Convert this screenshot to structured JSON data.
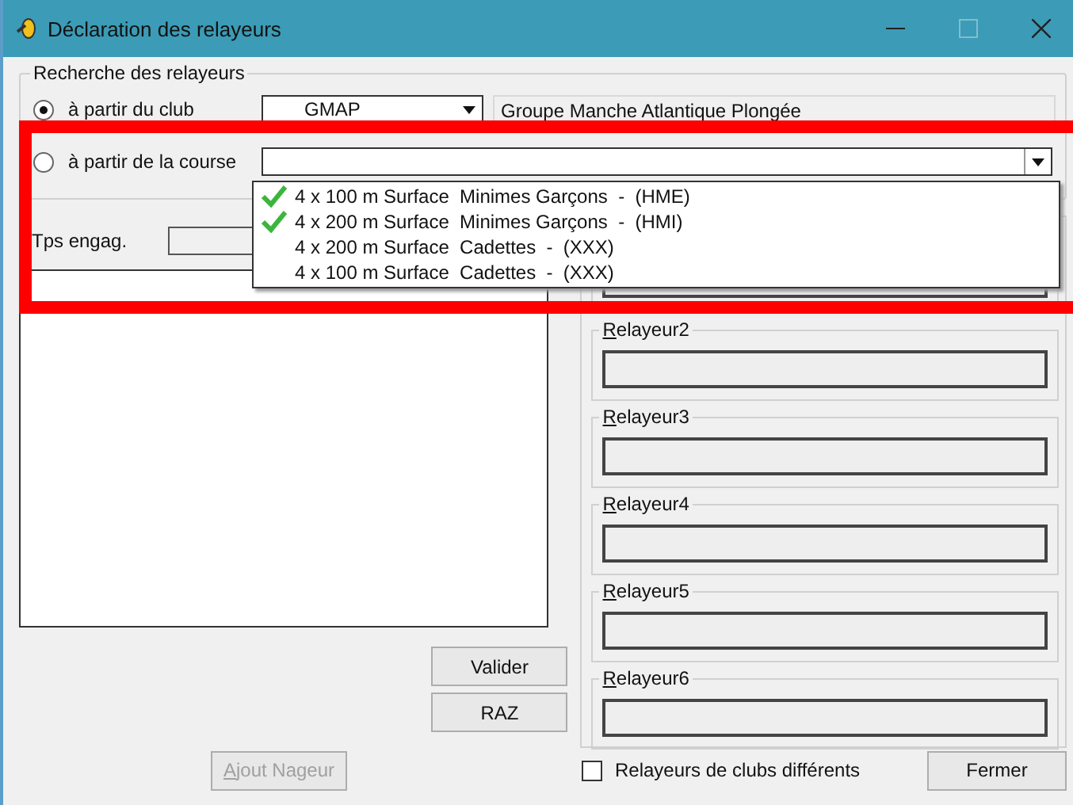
{
  "window": {
    "title": "Déclaration des relayeurs"
  },
  "search_group": {
    "legend": "Recherche des relayeurs",
    "club_option": {
      "label": "à partir du club",
      "selected": true,
      "combo_value": "GMAP",
      "club_name": "Groupe Manche Atlantique Plongée"
    },
    "course_option": {
      "label": "à partir de la course",
      "selected": false
    }
  },
  "course_dropdown": {
    "items": [
      {
        "label": "4 x 100 m Surface  Minimes Garçons  -  (HME)",
        "checked": true
      },
      {
        "label": "4 x 200 m Surface  Minimes Garçons  -  (HMI)",
        "checked": true
      },
      {
        "label": "4 x 200 m Surface  Cadettes  -  (XXX)",
        "checked": false
      },
      {
        "label": "4 x 100 m Surface  Cadettes  -  (XXX)",
        "checked": false
      }
    ]
  },
  "tps_engag": {
    "label": "Tps engag."
  },
  "relayeurs": [
    {
      "label": "Relayeur2"
    },
    {
      "label": "Relayeur3"
    },
    {
      "label": "Relayeur4"
    },
    {
      "label": "Relayeur5"
    },
    {
      "label": "Relayeur6"
    }
  ],
  "action_buttons": [
    "Valider",
    "RAZ"
  ],
  "ajout_nageur": {
    "label": "Ajout Nageur",
    "disabled": true
  },
  "mixed_clubs": {
    "label": "Relayeurs de clubs différents",
    "checked": false
  },
  "close_button": "Fermer"
}
